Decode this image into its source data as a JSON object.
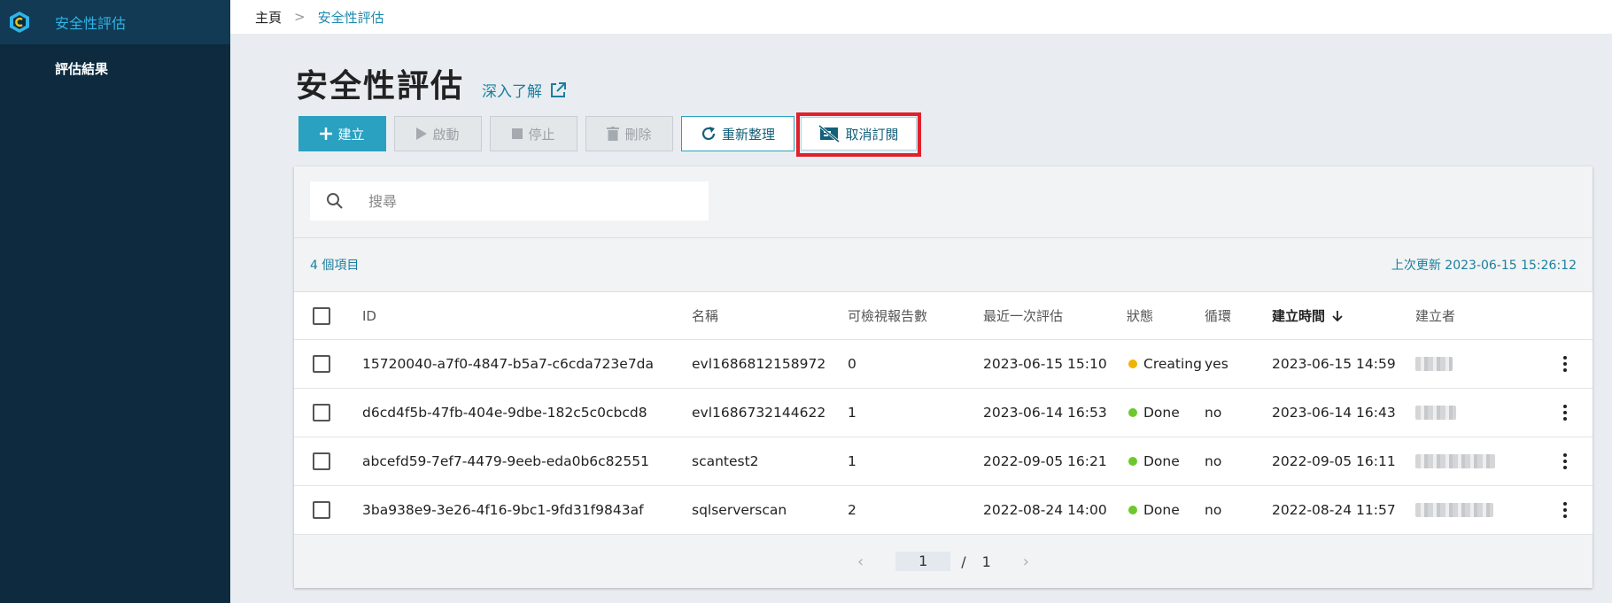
{
  "sidebar": {
    "active_label": "安全性評估",
    "items": [
      {
        "label": "評估結果"
      }
    ]
  },
  "breadcrumb": {
    "home": "主頁",
    "separator": ">",
    "current": "安全性評估"
  },
  "page": {
    "title": "安全性評估",
    "learn_more": "深入了解"
  },
  "toolbar": {
    "create": "建立",
    "start": "啟動",
    "stop": "停止",
    "delete": "刪除",
    "refresh": "重新整理",
    "unsubscribe": "取消訂閱"
  },
  "search": {
    "placeholder": "搜尋"
  },
  "summary": {
    "count": "4 個項目",
    "last_updated": "上次更新 2023-06-15 15:26:12"
  },
  "table": {
    "columns": {
      "id": "ID",
      "name": "名稱",
      "reports": "可檢視報告數",
      "last_eval": "最近一次評估",
      "status": "狀態",
      "cycle": "循環",
      "created": "建立時間",
      "creator": "建立者"
    },
    "rows": [
      {
        "id": "15720040-a7f0-4847-b5a7-c6cda723e7da",
        "name": "evl1686812158972",
        "reports": "0",
        "last_eval": "2023-06-15 15:10",
        "status": "Creating",
        "status_color": "#f0b400",
        "cycle": "yes",
        "created": "2023-06-15 14:59"
      },
      {
        "id": "d6cd4f5b-47fb-404e-9dbe-182c5c0cbcd8",
        "name": "evl1686732144622",
        "reports": "1",
        "last_eval": "2023-06-14 16:53",
        "status": "Done",
        "status_color": "#6cc82c",
        "cycle": "no",
        "created": "2023-06-14 16:43"
      },
      {
        "id": "abcefd59-7ef7-4479-9eeb-eda0b6c82551",
        "name": "scantest2",
        "reports": "1",
        "last_eval": "2022-09-05 16:21",
        "status": "Done",
        "status_color": "#6cc82c",
        "cycle": "no",
        "created": "2022-09-05 16:11"
      },
      {
        "id": "3ba938e9-3e26-4f16-9bc1-9fd31f9843af",
        "name": "sqlserverscan",
        "reports": "2",
        "last_eval": "2022-08-24 14:00",
        "status": "Done",
        "status_color": "#6cc82c",
        "cycle": "no",
        "created": "2022-08-24 11:57"
      }
    ]
  },
  "pagination": {
    "current": "1",
    "separator": "/",
    "total": "1",
    "prev": "‹",
    "next": "›"
  },
  "colors": {
    "accent": "#2aa1c0",
    "sidebar_bg": "#0d2a3f",
    "highlight_border": "#e2202c"
  }
}
